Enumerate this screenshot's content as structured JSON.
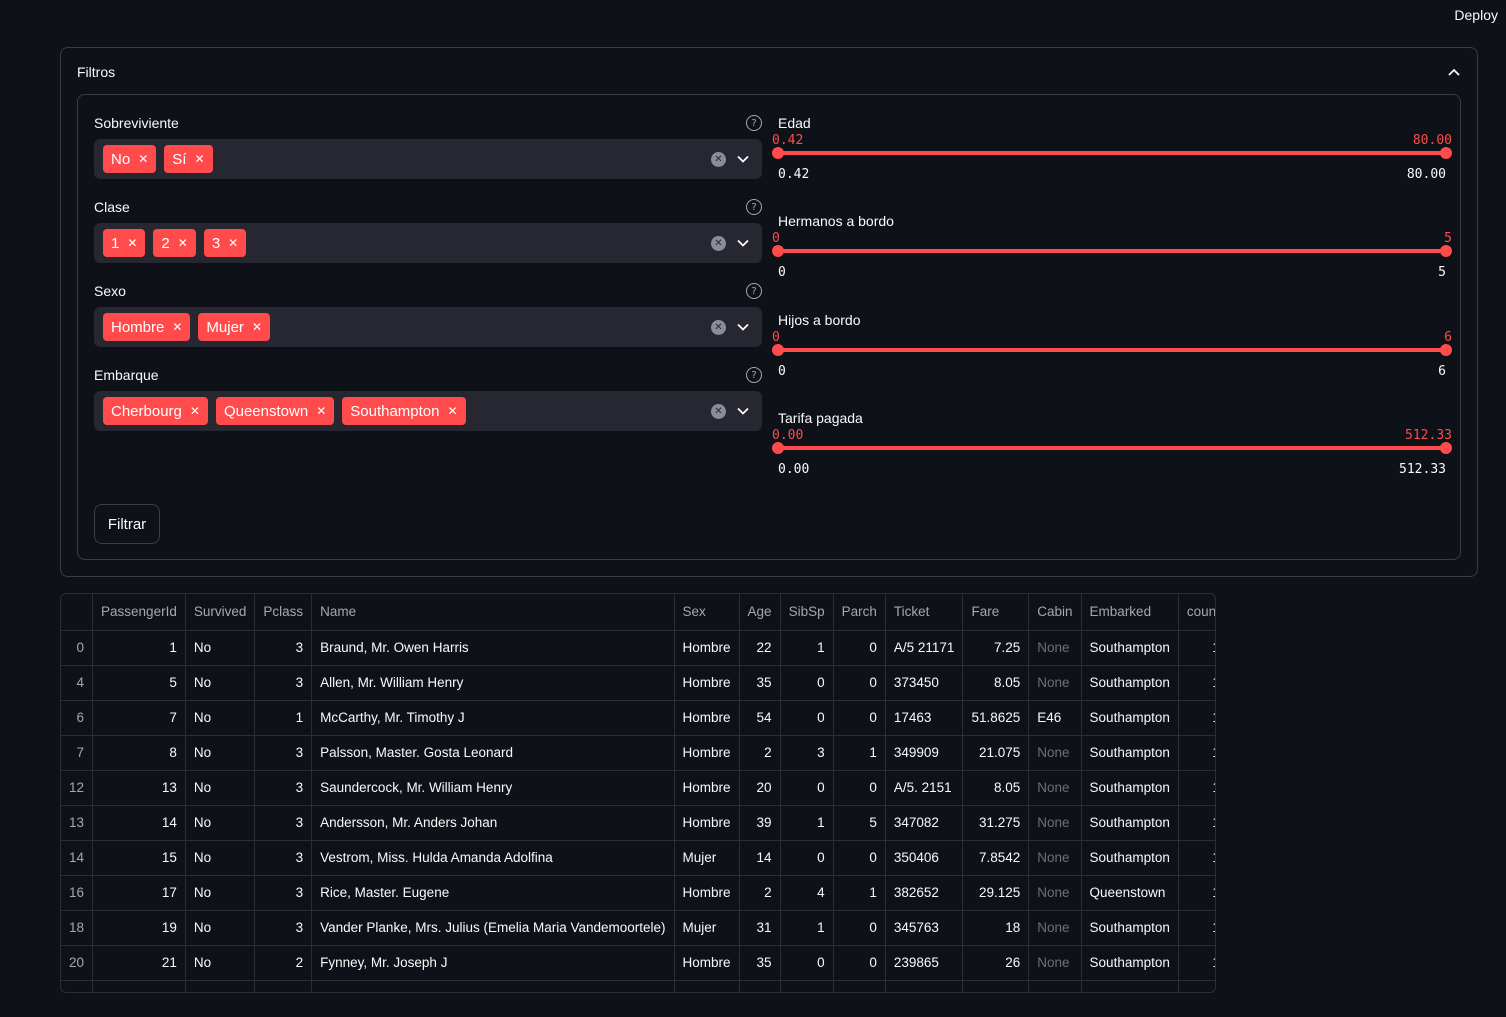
{
  "header": {
    "deploy_label": "Deploy"
  },
  "expander": {
    "title": "Filtros"
  },
  "filters": {
    "multiselects": [
      {
        "label": "Sobreviviente",
        "tags": [
          "No",
          "Sí"
        ]
      },
      {
        "label": "Clase",
        "tags": [
          "1",
          "2",
          "3"
        ]
      },
      {
        "label": "Sexo",
        "tags": [
          "Hombre",
          "Mujer"
        ]
      },
      {
        "label": "Embarque",
        "tags": [
          "Cherbourg",
          "Queenstown",
          "Southampton"
        ]
      }
    ],
    "sliders": [
      {
        "label": "Edad",
        "low": "0.42",
        "high": "80.00",
        "min": "0.42",
        "max": "80.00"
      },
      {
        "label": "Hermanos a bordo",
        "low": "0",
        "high": "5",
        "min": "0",
        "max": "5"
      },
      {
        "label": "Hijos a bordo",
        "low": "0",
        "high": "6",
        "min": "0",
        "max": "6"
      },
      {
        "label": "Tarifa pagada",
        "low": "0.00",
        "high": "512.33",
        "min": "0.00",
        "max": "512.33"
      }
    ],
    "submit_label": "Filtrar",
    "help_glyph": "?",
    "tag_close_glyph": "✕",
    "clear_glyph": "✕"
  },
  "colors": {
    "accent": "#ff4b4b",
    "background": "#0e1117",
    "input_bg": "#262730"
  },
  "table": {
    "columns": [
      "",
      "PassengerId",
      "Survived",
      "Pclass",
      "Name",
      "Sex",
      "Age",
      "SibSp",
      "Parch",
      "Ticket",
      "Fare",
      "Cabin",
      "Embarked",
      "count"
    ],
    "rows": [
      [
        "0",
        "1",
        "No",
        "3",
        "Braund, Mr. Owen Harris",
        "Hombre",
        "22",
        "1",
        "0",
        "A/5 21171",
        "7.25",
        "None",
        "Southampton",
        "1"
      ],
      [
        "4",
        "5",
        "No",
        "3",
        "Allen, Mr. William Henry",
        "Hombre",
        "35",
        "0",
        "0",
        "373450",
        "8.05",
        "None",
        "Southampton",
        "1"
      ],
      [
        "6",
        "7",
        "No",
        "1",
        "McCarthy, Mr. Timothy J",
        "Hombre",
        "54",
        "0",
        "0",
        "17463",
        "51.8625",
        "E46",
        "Southampton",
        "1"
      ],
      [
        "7",
        "8",
        "No",
        "3",
        "Palsson, Master. Gosta Leonard",
        "Hombre",
        "2",
        "3",
        "1",
        "349909",
        "21.075",
        "None",
        "Southampton",
        "1"
      ],
      [
        "12",
        "13",
        "No",
        "3",
        "Saundercock, Mr. William Henry",
        "Hombre",
        "20",
        "0",
        "0",
        "A/5. 2151",
        "8.05",
        "None",
        "Southampton",
        "1"
      ],
      [
        "13",
        "14",
        "No",
        "3",
        "Andersson, Mr. Anders Johan",
        "Hombre",
        "39",
        "1",
        "5",
        "347082",
        "31.275",
        "None",
        "Southampton",
        "1"
      ],
      [
        "14",
        "15",
        "No",
        "3",
        "Vestrom, Miss. Hulda Amanda Adolfina",
        "Mujer",
        "14",
        "0",
        "0",
        "350406",
        "7.8542",
        "None",
        "Southampton",
        "1"
      ],
      [
        "16",
        "17",
        "No",
        "3",
        "Rice, Master. Eugene",
        "Hombre",
        "2",
        "4",
        "1",
        "382652",
        "29.125",
        "None",
        "Queenstown",
        "1"
      ],
      [
        "18",
        "19",
        "No",
        "3",
        "Vander Planke, Mrs. Julius (Emelia Maria Vandemoortele)",
        "Mujer",
        "31",
        "1",
        "0",
        "345763",
        "18",
        "None",
        "Southampton",
        "1"
      ],
      [
        "20",
        "21",
        "No",
        "2",
        "Fynney, Mr. Joseph J",
        "Hombre",
        "35",
        "0",
        "0",
        "239865",
        "26",
        "None",
        "Southampton",
        "1"
      ]
    ]
  }
}
